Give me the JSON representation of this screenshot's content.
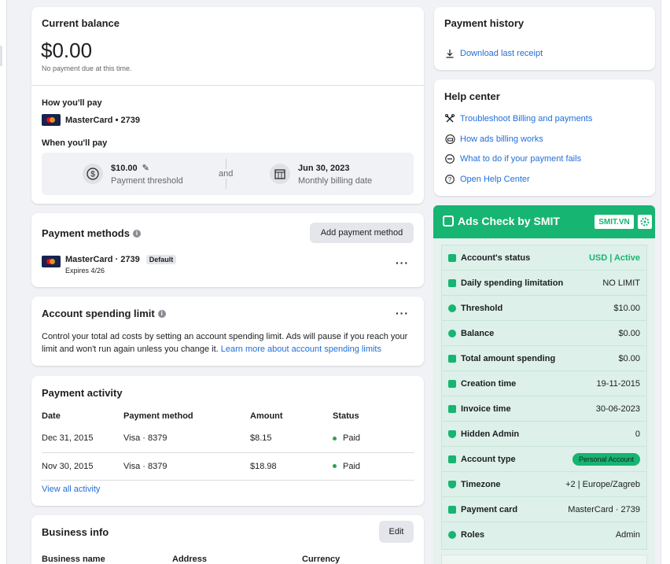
{
  "balance": {
    "title": "Current balance",
    "amount": "$0.00",
    "note": "No payment due at this time.",
    "how_label": "How you'll pay",
    "card_label": "MasterCard • 2739",
    "when_label": "When you'll pay",
    "threshold_value": "$10.00",
    "threshold_label": "Payment threshold",
    "and": "and",
    "billing_date": "Jun 30, 2023",
    "billing_label": "Monthly billing date"
  },
  "methods": {
    "title": "Payment methods",
    "add_button": "Add payment method",
    "card_label": "MasterCard · 2739",
    "default_badge": "Default",
    "expires": "Expires 4/26"
  },
  "spending": {
    "title": "Account spending limit",
    "body": "Control your total ad costs by setting an account spending limit. Ads will pause if you reach your limit and won't run again unless you change it.",
    "link": "Learn more about account spending limits"
  },
  "activity": {
    "title": "Payment activity",
    "headers": [
      "Date",
      "Payment method",
      "Amount",
      "Status"
    ],
    "rows": [
      {
        "date": "Dec 31, 2015",
        "method": "Visa · 8379",
        "amount": "$8.15",
        "status": "Paid"
      },
      {
        "date": "Nov 30, 2015",
        "method": "Visa · 8379",
        "amount": "$18.98",
        "status": "Paid"
      }
    ],
    "view_all": "View all activity"
  },
  "business": {
    "title": "Business info",
    "edit_button": "Edit",
    "headers": [
      "Business name",
      "Address",
      "Currency"
    ]
  },
  "history": {
    "title": "Payment history",
    "download": "Download last receipt"
  },
  "help": {
    "title": "Help center",
    "links": [
      {
        "label": "Troubleshoot Billing and payments",
        "icon": "wrench-icon"
      },
      {
        "label": "How ads billing works",
        "icon": "car-icon"
      },
      {
        "label": "What to do if your payment fails",
        "icon": "minus-circle-icon"
      },
      {
        "label": "Open Help Center",
        "icon": "question-circle-icon"
      }
    ]
  },
  "smit": {
    "name": "Ads Check by SMIT",
    "badge": "SMIT.VN",
    "accent": "#16b571",
    "rows": [
      {
        "label": "Account's status",
        "value": "USD | Active"
      },
      {
        "label": "Daily spending limitation",
        "value": "NO LIMIT"
      },
      {
        "label": "Threshold",
        "value": "$10.00"
      },
      {
        "label": "Balance",
        "value": "$0.00"
      },
      {
        "label": "Total amount spending",
        "value": "$0.00"
      },
      {
        "label": "Creation time",
        "value": "19-11-2015"
      },
      {
        "label": "Invoice time",
        "value": "30-06-2023"
      },
      {
        "label": "Hidden Admin",
        "value": "0"
      },
      {
        "label": "Account type",
        "value": "Personal Account"
      },
      {
        "label": "Timezone",
        "value": "+2 | Europe/Zagreb"
      },
      {
        "label": "Payment card",
        "value": "MasterCard · 2739"
      },
      {
        "label": "Roles",
        "value": "Admin"
      }
    ]
  }
}
